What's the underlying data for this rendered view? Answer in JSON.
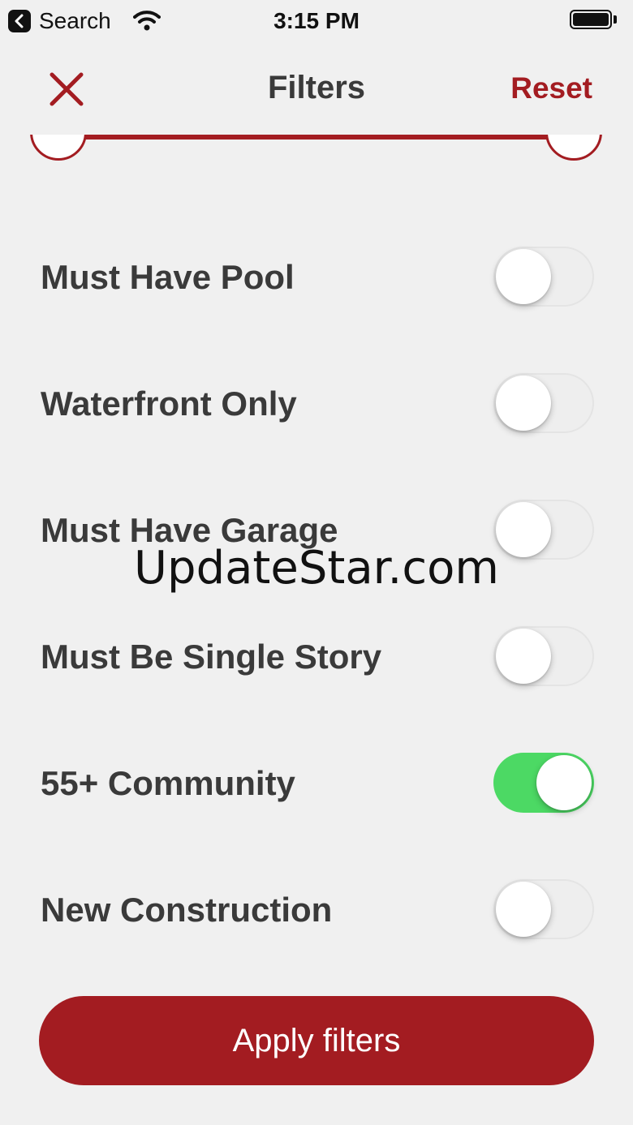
{
  "status_bar": {
    "back_app_label": "Search",
    "time": "3:15 PM"
  },
  "nav": {
    "title": "Filters",
    "reset_label": "Reset"
  },
  "filters": [
    {
      "label": "Must Have Pool",
      "on": false
    },
    {
      "label": "Waterfront Only",
      "on": false
    },
    {
      "label": "Must Have Garage",
      "on": false
    },
    {
      "label": "Must Be Single Story",
      "on": false
    },
    {
      "label": "55+ Community",
      "on": true
    },
    {
      "label": "New Construction",
      "on": false
    }
  ],
  "watermark": "UpdateStar.com",
  "apply_label": "Apply filters",
  "colors": {
    "accent": "#a31c21",
    "toggle_on": "#4cd964",
    "background": "#f0f0f0"
  },
  "icons": {
    "close": "close-icon",
    "back": "chevron-left-icon",
    "wifi": "wifi-icon",
    "battery": "battery-icon"
  }
}
